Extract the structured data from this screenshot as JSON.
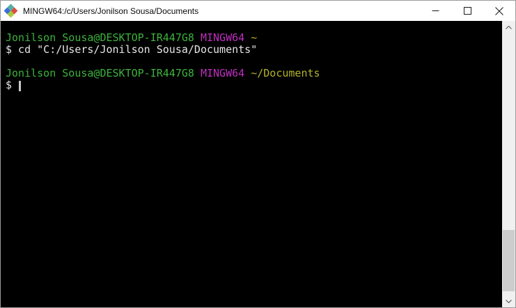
{
  "window": {
    "title": "MINGW64:/c/Users/Jonilson Sousa/Documents",
    "icon": "git-bash-msys-diamond-icon",
    "control_icons": [
      "minimize-icon",
      "maximize-icon",
      "close-icon"
    ]
  },
  "terminal": {
    "lines": [
      {
        "segments": [
          {
            "t": "Jonilson Sousa@DESKTOP-IR447G8",
            "c": "green"
          },
          {
            "t": " ",
            "c": "fg"
          },
          {
            "t": "MINGW64",
            "c": "magenta"
          },
          {
            "t": " ",
            "c": "fg"
          },
          {
            "t": "~",
            "c": "yellow"
          }
        ]
      },
      {
        "segments": [
          {
            "t": "$ cd \"C:/Users/Jonilson Sousa/Documents\"",
            "c": "fg"
          }
        ]
      },
      {
        "segments": []
      },
      {
        "segments": [
          {
            "t": "Jonilson Sousa@DESKTOP-IR447G8",
            "c": "green"
          },
          {
            "t": " ",
            "c": "fg"
          },
          {
            "t": "MINGW64",
            "c": "magenta"
          },
          {
            "t": " ",
            "c": "fg"
          },
          {
            "t": "~/Documents",
            "c": "yellow"
          }
        ]
      },
      {
        "segments": [
          {
            "t": "$ ",
            "c": "fg"
          }
        ],
        "cursor": true
      }
    ],
    "scrollbar_icons": [
      "chevron-up-icon",
      "chevron-down-icon"
    ]
  },
  "colors": {
    "titlebar_bg": "#ffffff",
    "terminal_bg": "#000000",
    "terminal_fg": "#e6e6e6",
    "prompt_green": "#3cb43c",
    "prompt_magenta": "#c02ec0",
    "path_yellow": "#b2b22c",
    "scrollbar_track": "#f0f0f0",
    "scrollbar_thumb": "#cdcdcd",
    "icon_teal": "#52b0a4",
    "icon_red": "#d94f3d",
    "icon_blue": "#3b6fd4",
    "icon_green": "#a8c83c"
  }
}
